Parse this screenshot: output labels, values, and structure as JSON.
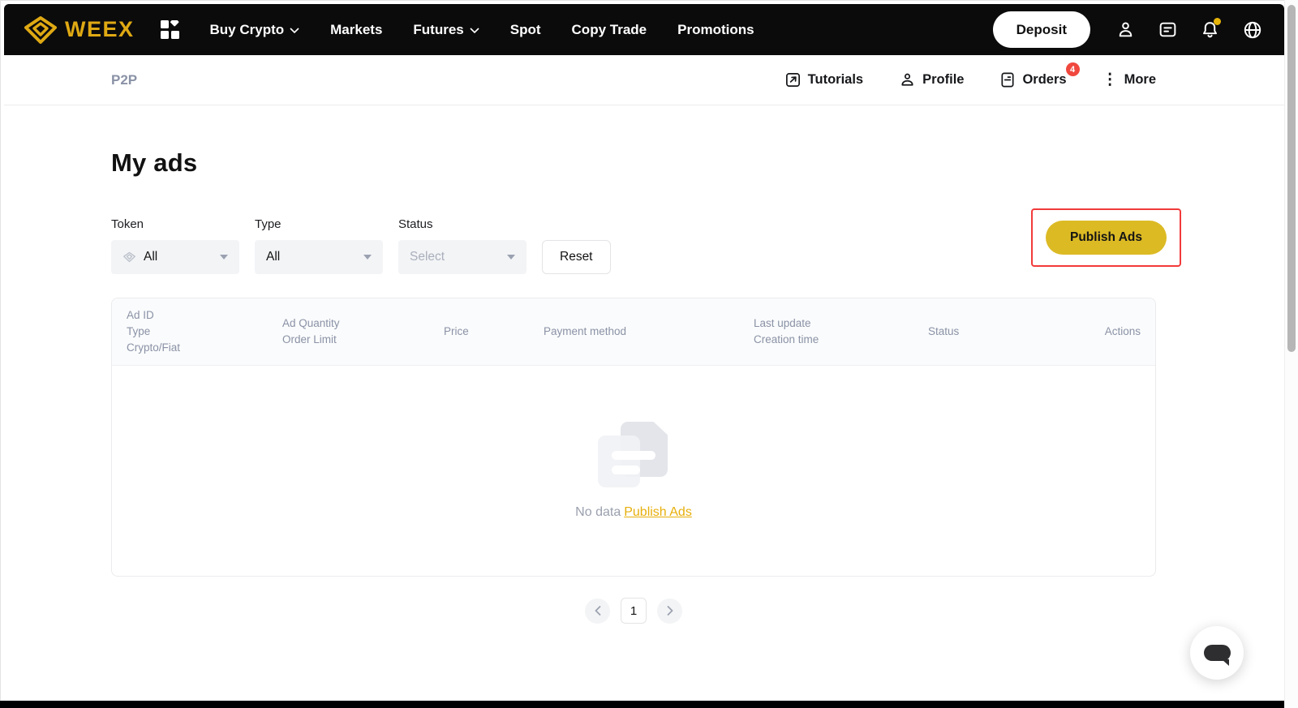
{
  "brand": {
    "name": "WEEX"
  },
  "colors": {
    "brand_gold": "#dfa913",
    "button_gold": "#dcba24",
    "link_gold": "#e7af0b",
    "badge_red": "#f0483e",
    "highlight_red": "#f23a3a"
  },
  "topnav": {
    "items": [
      {
        "label": "Buy Crypto",
        "chevron": true
      },
      {
        "label": "Markets",
        "chevron": false
      },
      {
        "label": "Futures",
        "chevron": true
      },
      {
        "label": "Spot",
        "chevron": false
      },
      {
        "label": "Copy Trade",
        "chevron": false
      },
      {
        "label": "Promotions",
        "chevron": false
      }
    ],
    "deposit_label": "Deposit",
    "icons": [
      "apps-grid-icon",
      "user-icon",
      "support-chat-icon",
      "bell-icon",
      "globe-icon"
    ],
    "bell_has_dot": true
  },
  "subnav": {
    "breadcrumb": "P2P",
    "items": [
      {
        "label": "Tutorials",
        "icon": "tutorials-icon"
      },
      {
        "label": "Profile",
        "icon": "profile-icon"
      },
      {
        "label": "Orders",
        "icon": "orders-icon",
        "badge": "4"
      },
      {
        "label": "More",
        "icon": "more-dots-icon"
      }
    ]
  },
  "page": {
    "title": "My ads"
  },
  "filters": {
    "token": {
      "label": "Token",
      "value": "All",
      "icon": "token-gem-icon"
    },
    "type": {
      "label": "Type",
      "value": "All"
    },
    "status": {
      "label": "Status",
      "placeholder": "Select"
    },
    "reset_label": "Reset",
    "publish_label": "Publish Ads"
  },
  "table": {
    "columns": [
      {
        "lines": [
          "Ad ID",
          "Type",
          "Crypto/Fiat"
        ]
      },
      {
        "lines": [
          "Ad Quantity",
          "Order Limit"
        ]
      },
      {
        "lines": [
          "Price"
        ]
      },
      {
        "lines": [
          "Payment method"
        ]
      },
      {
        "lines": [
          "Last update",
          "Creation time"
        ]
      },
      {
        "lines": [
          "Status"
        ]
      },
      {
        "lines": [
          "Actions"
        ]
      }
    ],
    "empty": {
      "text": "No data",
      "link_label": "Publish Ads"
    }
  },
  "pagination": {
    "current": "1"
  }
}
